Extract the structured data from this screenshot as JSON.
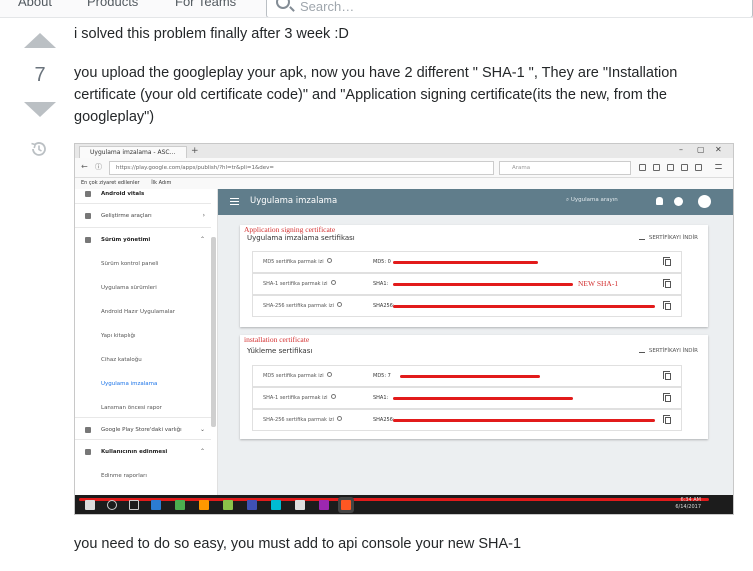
{
  "topnav": {
    "items": [
      "About",
      "Products",
      "For Teams"
    ],
    "search_placeholder": "Search…"
  },
  "vote": {
    "count": "7"
  },
  "post": {
    "line1": "i solved this problem finally after 3 week :D",
    "paragraph2": "you upload the googleplay your apk, now you have 2 different \" SHA-1 \", They are \"Installation certificate (your old certificate code)\" and \"Application signing certificate(its the new, from the googleplay\")",
    "closing": "you need to do so easy, you must add to api console your new SHA-1"
  },
  "screenshot": {
    "browser": {
      "tab_title": "Uygulama imzalama - ASC...",
      "url": "https://play.google.com/apps/publish/?hl=tr&pli=1&dev=",
      "search_placeholder": "Arama",
      "bookmarks": [
        "En çok ziyaret edilenler",
        "İlk Adım"
      ]
    },
    "sidebar": {
      "items": [
        {
          "label": "Android vitals",
          "type": "group"
        },
        {
          "label": "Geliştirme araçları",
          "type": "group",
          "chev": "›"
        },
        {
          "label": "Sürüm yönetimi",
          "type": "group",
          "chev": "⌃"
        },
        {
          "label": "Sürüm kontrol paneli",
          "type": "sub"
        },
        {
          "label": "Uygulama sürümleri",
          "type": "sub"
        },
        {
          "label": "Android Hazır Uygulamalar",
          "type": "sub"
        },
        {
          "label": "Yapı kitaplığı",
          "type": "sub"
        },
        {
          "label": "Cihaz kataloğu",
          "type": "sub"
        },
        {
          "label": "Uygulama imzalama",
          "type": "active"
        },
        {
          "label": "Lansman öncesi rapor",
          "type": "sub"
        },
        {
          "label": "Google Play Store'daki varlığı",
          "type": "group",
          "chev": "⌄"
        },
        {
          "label": "Kullanıcının edinmesi",
          "type": "group",
          "chev": "⌃"
        },
        {
          "label": "Edinme raporları",
          "type": "sub"
        }
      ]
    },
    "appbar": {
      "title": "Uygulama imzalama",
      "search": "Uygulama arayın"
    },
    "card1": {
      "annotation": "Application signing certificate",
      "title": "Uygulama imzalama sertifikası",
      "download": "SERTİFİKAYI İNDİR",
      "rows": [
        {
          "label": "MD5 sertifika parmak izi",
          "value": "MD5: 0"
        },
        {
          "label": "SHA-1 sertifika parmak izi",
          "value": "SHA1: "
        },
        {
          "label": "SHA-256 sertifika parmak izi",
          "value": "SHA256: "
        }
      ],
      "new_sha_note": "NEW SHA-1"
    },
    "card2": {
      "annotation": "installation certificate",
      "title": "Yükleme sertifikası",
      "download": "SERTİFİKAYI İNDİR",
      "rows": [
        {
          "label": "MD5 sertifika parmak izi",
          "value": "MD5: 7"
        },
        {
          "label": "SHA-1 sertifika parmak izi",
          "value": "SHA1: "
        },
        {
          "label": "SHA-256 sertifika parmak izi",
          "value": "SHA256: "
        }
      ]
    },
    "taskbar": {
      "time": "6:34 AM",
      "date": "6/14/2017"
    }
  },
  "colors": {
    "appbar": "#607d8b",
    "redaction": "#e21b1b",
    "annotation": "#d32f2f",
    "vote_arrow": "#bbc0c4"
  }
}
